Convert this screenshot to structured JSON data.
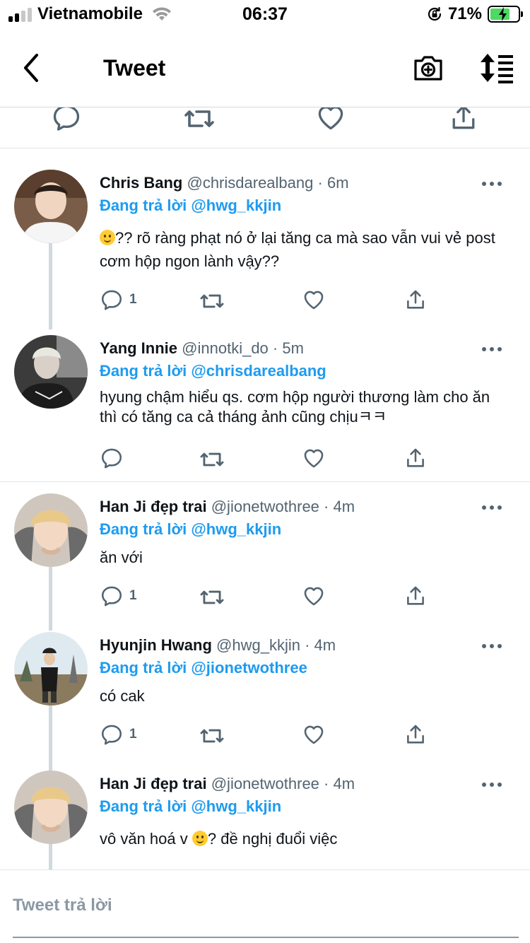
{
  "status_bar": {
    "carrier": "Vietnamobile",
    "time": "06:37",
    "battery_percent": "71%",
    "battery_level": 0.71,
    "battery_color": "#4cd964",
    "signal_bars": 2,
    "icons": [
      "signal-icon",
      "wifi-icon",
      "orientation-lock-icon",
      "battery-charging-icon"
    ]
  },
  "nav": {
    "back_icon": "chevron-left-icon",
    "title": "Tweet",
    "camera_icon": "camera-plus-icon",
    "sort_icon": "sort-icon"
  },
  "colors": {
    "accent": "#1d9bf0",
    "text": "#0f1419",
    "muted": "#536471",
    "divider": "#e1e6ea",
    "thread_line": "#cfd9de"
  },
  "tweets": [
    {
      "name": "Chris Bang",
      "handle": "@chrisdarealbang",
      "dot": "·",
      "time": "6m",
      "reply_prefix": "Đang trả lời",
      "reply_to": "@hwg_kkjin",
      "text_after_emoji": "?? rõ ràng phạt nó ở lại tăng ca mà sao vẫn vui vẻ post cơm hộp ngon lành vậy??",
      "reply_count": "1"
    },
    {
      "name": "Yang Innie",
      "handle": "@innotki_do",
      "dot": "·",
      "time": "5m",
      "reply_prefix": "Đang trả lời",
      "reply_to": "@chrisdarealbang",
      "text": "hyung chậm hiểu qs. cơm hộp người thương làm cho ăn thì có tăng ca cả tháng ảnh cũng chịuㅋㅋ",
      "reply_count": ""
    },
    {
      "name": "Han Ji đẹp trai",
      "handle": "@jionetwothree",
      "dot": "·",
      "time": "4m",
      "reply_prefix": "Đang trả lời",
      "reply_to": "@hwg_kkjin",
      "text": "ăn với",
      "reply_count": "1"
    },
    {
      "name": "Hyunjin Hwang",
      "handle": "@hwg_kkjin",
      "dot": "·",
      "time": "4m",
      "reply_prefix": "Đang trả lời",
      "reply_to": "@jionetwothree",
      "text": "có cak",
      "reply_count": "1"
    },
    {
      "name": "Han Ji đẹp trai",
      "handle": "@jionetwothree",
      "dot": "·",
      "time": "4m",
      "reply_prefix": "Đang trả lời",
      "reply_to": "@hwg_kkjin",
      "text_before_emoji": "vô văn hoá v",
      "text_after_emoji": "? đề nghị đuổi việc",
      "reply_count": ""
    }
  ],
  "action_icons": [
    "reply-icon",
    "retweet-icon",
    "like-icon",
    "share-icon"
  ],
  "composer": {
    "placeholder": "Tweet trả lời"
  }
}
